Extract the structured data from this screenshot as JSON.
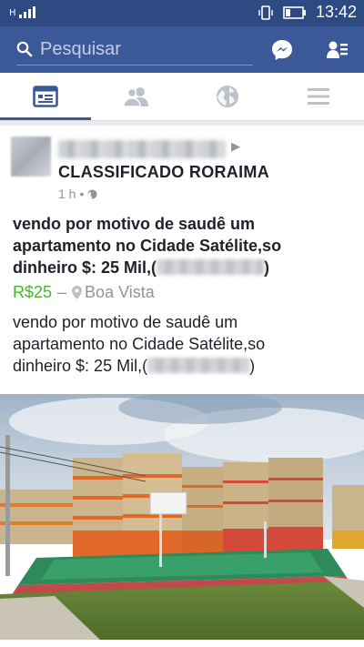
{
  "status_bar": {
    "time": "13:42",
    "network": "H"
  },
  "top_bar": {
    "search_placeholder": "Pesquisar"
  },
  "tabs": [
    {
      "name": "feed",
      "active": true
    },
    {
      "name": "friends",
      "active": false
    },
    {
      "name": "notifications",
      "active": false
    },
    {
      "name": "menu",
      "active": false
    }
  ],
  "post": {
    "group_name": "CLASSIFICADO RORAIMA",
    "time": "1 h",
    "title_line1": "vendo por motivo de saudê um",
    "title_line2": "apartamento no Cidade Satélite,so",
    "title_line3_prefix": "dinheiro $: 25 Mil,(",
    "title_line3_suffix": ")",
    "price": "R$25",
    "price_separator": "–",
    "location": "Boa Vista",
    "desc_line1": "vendo por motivo de saudê um",
    "desc_line2": "apartamento no Cidade Satélite,so",
    "desc_line3_prefix": "dinheiro $: 25 Mil,(",
    "desc_line3_suffix": ")"
  },
  "colors": {
    "brand": "#3b5998",
    "status_bar": "#2d4a82",
    "price": "#42b72a",
    "meta": "#90949c"
  }
}
